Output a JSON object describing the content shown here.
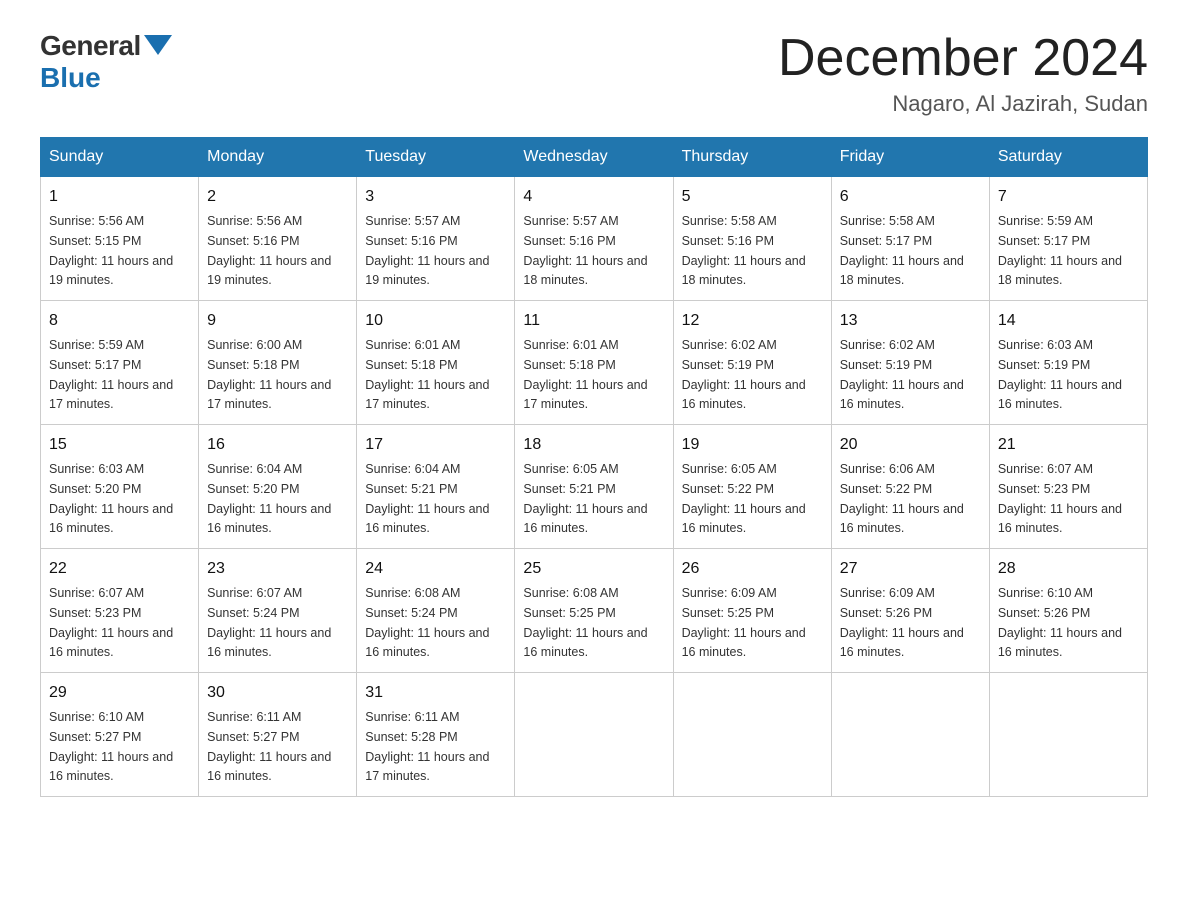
{
  "logo": {
    "general_text": "General",
    "blue_text": "Blue"
  },
  "header": {
    "month_year": "December 2024",
    "location": "Nagaro, Al Jazirah, Sudan"
  },
  "days_of_week": [
    "Sunday",
    "Monday",
    "Tuesday",
    "Wednesday",
    "Thursday",
    "Friday",
    "Saturday"
  ],
  "weeks": [
    [
      {
        "day": "1",
        "sunrise": "5:56 AM",
        "sunset": "5:15 PM",
        "daylight": "11 hours and 19 minutes."
      },
      {
        "day": "2",
        "sunrise": "5:56 AM",
        "sunset": "5:16 PM",
        "daylight": "11 hours and 19 minutes."
      },
      {
        "day": "3",
        "sunrise": "5:57 AM",
        "sunset": "5:16 PM",
        "daylight": "11 hours and 19 minutes."
      },
      {
        "day": "4",
        "sunrise": "5:57 AM",
        "sunset": "5:16 PM",
        "daylight": "11 hours and 18 minutes."
      },
      {
        "day": "5",
        "sunrise": "5:58 AM",
        "sunset": "5:16 PM",
        "daylight": "11 hours and 18 minutes."
      },
      {
        "day": "6",
        "sunrise": "5:58 AM",
        "sunset": "5:17 PM",
        "daylight": "11 hours and 18 minutes."
      },
      {
        "day": "7",
        "sunrise": "5:59 AM",
        "sunset": "5:17 PM",
        "daylight": "11 hours and 18 minutes."
      }
    ],
    [
      {
        "day": "8",
        "sunrise": "5:59 AM",
        "sunset": "5:17 PM",
        "daylight": "11 hours and 17 minutes."
      },
      {
        "day": "9",
        "sunrise": "6:00 AM",
        "sunset": "5:18 PM",
        "daylight": "11 hours and 17 minutes."
      },
      {
        "day": "10",
        "sunrise": "6:01 AM",
        "sunset": "5:18 PM",
        "daylight": "11 hours and 17 minutes."
      },
      {
        "day": "11",
        "sunrise": "6:01 AM",
        "sunset": "5:18 PM",
        "daylight": "11 hours and 17 minutes."
      },
      {
        "day": "12",
        "sunrise": "6:02 AM",
        "sunset": "5:19 PM",
        "daylight": "11 hours and 16 minutes."
      },
      {
        "day": "13",
        "sunrise": "6:02 AM",
        "sunset": "5:19 PM",
        "daylight": "11 hours and 16 minutes."
      },
      {
        "day": "14",
        "sunrise": "6:03 AM",
        "sunset": "5:19 PM",
        "daylight": "11 hours and 16 minutes."
      }
    ],
    [
      {
        "day": "15",
        "sunrise": "6:03 AM",
        "sunset": "5:20 PM",
        "daylight": "11 hours and 16 minutes."
      },
      {
        "day": "16",
        "sunrise": "6:04 AM",
        "sunset": "5:20 PM",
        "daylight": "11 hours and 16 minutes."
      },
      {
        "day": "17",
        "sunrise": "6:04 AM",
        "sunset": "5:21 PM",
        "daylight": "11 hours and 16 minutes."
      },
      {
        "day": "18",
        "sunrise": "6:05 AM",
        "sunset": "5:21 PM",
        "daylight": "11 hours and 16 minutes."
      },
      {
        "day": "19",
        "sunrise": "6:05 AM",
        "sunset": "5:22 PM",
        "daylight": "11 hours and 16 minutes."
      },
      {
        "day": "20",
        "sunrise": "6:06 AM",
        "sunset": "5:22 PM",
        "daylight": "11 hours and 16 minutes."
      },
      {
        "day": "21",
        "sunrise": "6:07 AM",
        "sunset": "5:23 PM",
        "daylight": "11 hours and 16 minutes."
      }
    ],
    [
      {
        "day": "22",
        "sunrise": "6:07 AM",
        "sunset": "5:23 PM",
        "daylight": "11 hours and 16 minutes."
      },
      {
        "day": "23",
        "sunrise": "6:07 AM",
        "sunset": "5:24 PM",
        "daylight": "11 hours and 16 minutes."
      },
      {
        "day": "24",
        "sunrise": "6:08 AM",
        "sunset": "5:24 PM",
        "daylight": "11 hours and 16 minutes."
      },
      {
        "day": "25",
        "sunrise": "6:08 AM",
        "sunset": "5:25 PM",
        "daylight": "11 hours and 16 minutes."
      },
      {
        "day": "26",
        "sunrise": "6:09 AM",
        "sunset": "5:25 PM",
        "daylight": "11 hours and 16 minutes."
      },
      {
        "day": "27",
        "sunrise": "6:09 AM",
        "sunset": "5:26 PM",
        "daylight": "11 hours and 16 minutes."
      },
      {
        "day": "28",
        "sunrise": "6:10 AM",
        "sunset": "5:26 PM",
        "daylight": "11 hours and 16 minutes."
      }
    ],
    [
      {
        "day": "29",
        "sunrise": "6:10 AM",
        "sunset": "5:27 PM",
        "daylight": "11 hours and 16 minutes."
      },
      {
        "day": "30",
        "sunrise": "6:11 AM",
        "sunset": "5:27 PM",
        "daylight": "11 hours and 16 minutes."
      },
      {
        "day": "31",
        "sunrise": "6:11 AM",
        "sunset": "5:28 PM",
        "daylight": "11 hours and 17 minutes."
      },
      null,
      null,
      null,
      null
    ]
  ]
}
